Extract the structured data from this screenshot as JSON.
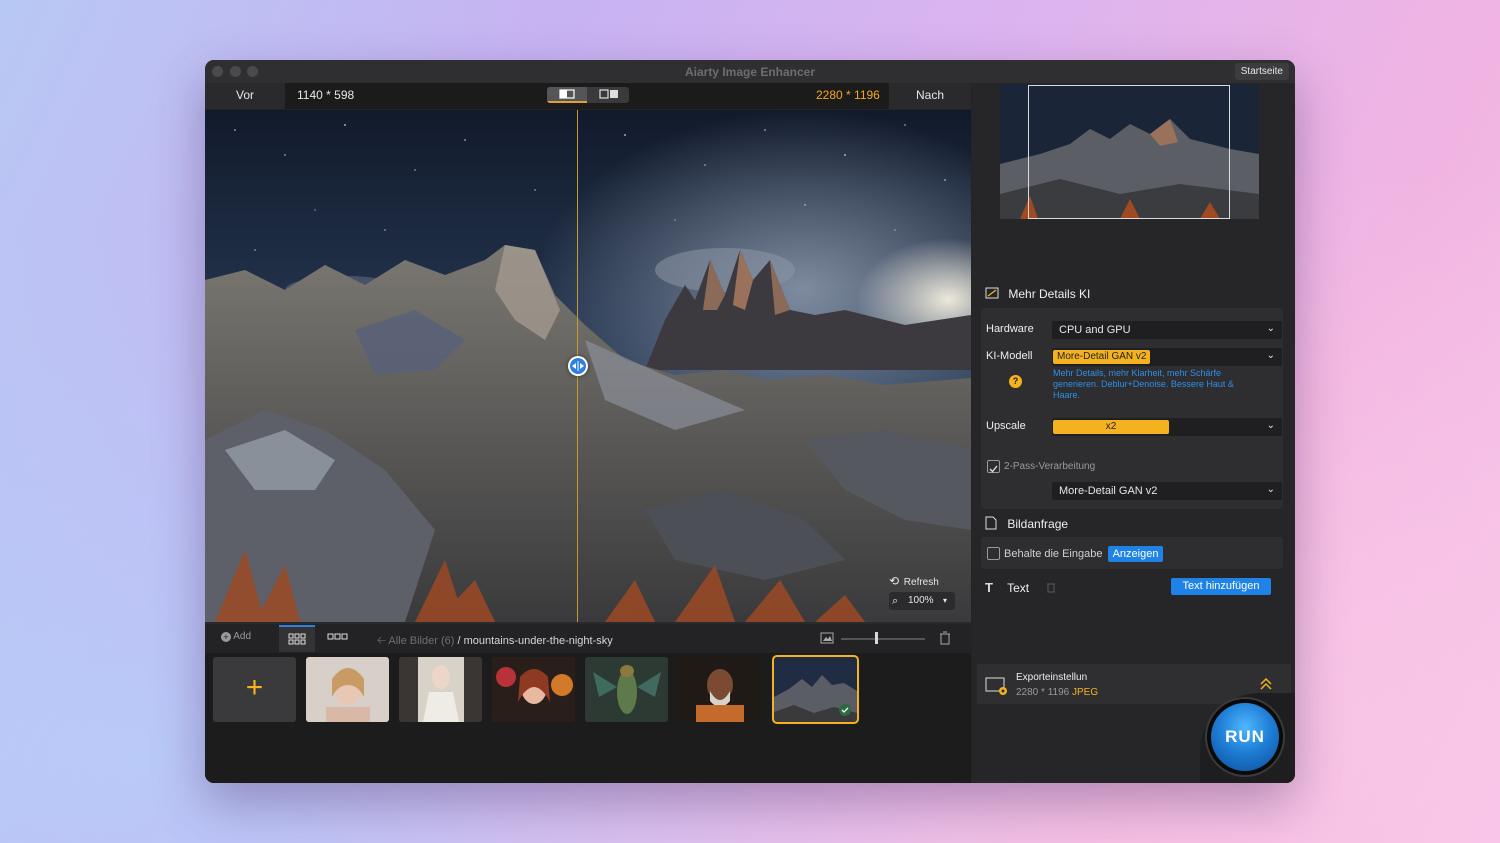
{
  "window": {
    "title": "Aiarty Image Enhancer",
    "home_button": "Startseite"
  },
  "infobar": {
    "before_label": "Vor",
    "before_dims": "1140 * 598",
    "after_dims": "2280 * 1196",
    "after_label": "Nach"
  },
  "preview": {
    "refresh_label": "Refresh",
    "zoom_value": "100%"
  },
  "gallery": {
    "add_label": "Add",
    "breadcrumb_root": "Alle Bilder (6)",
    "breadcrumb_current": "/ mountains-under-the-night-sky",
    "add_thumb_glyph": "+"
  },
  "panel": {
    "section_ai": "Mehr Details KI",
    "hardware_label": "Hardware",
    "hardware_value": "CPU and GPU",
    "model_label": "KI-Modell",
    "model_value": "More-Detail GAN v2",
    "model_description": "Mehr Details, mehr Klarheit, mehr Schärfe generieren. Deblur+Denoise. Bessere Haut & Haare.",
    "help_glyph": "?",
    "upscale_label": "Upscale",
    "upscale_value": "x2",
    "two_pass_label": "2-Pass-Verarbeitung",
    "two_pass_model": "More-Detail GAN v2",
    "prompt_section": "Bildanfrage",
    "keep_input_label": "Behalte die Eingabe",
    "show_button": "Anzeigen",
    "text_section": "Text",
    "add_text_button": "Text hinzufügen",
    "export_title": "Exporteinstellun",
    "export_dims": "2280 * 1196",
    "export_format": "JPEG",
    "run_button": "RUN"
  },
  "colors": {
    "accent": "#f4b31e",
    "blue": "#1f82e6",
    "panel_bg": "#262628"
  }
}
